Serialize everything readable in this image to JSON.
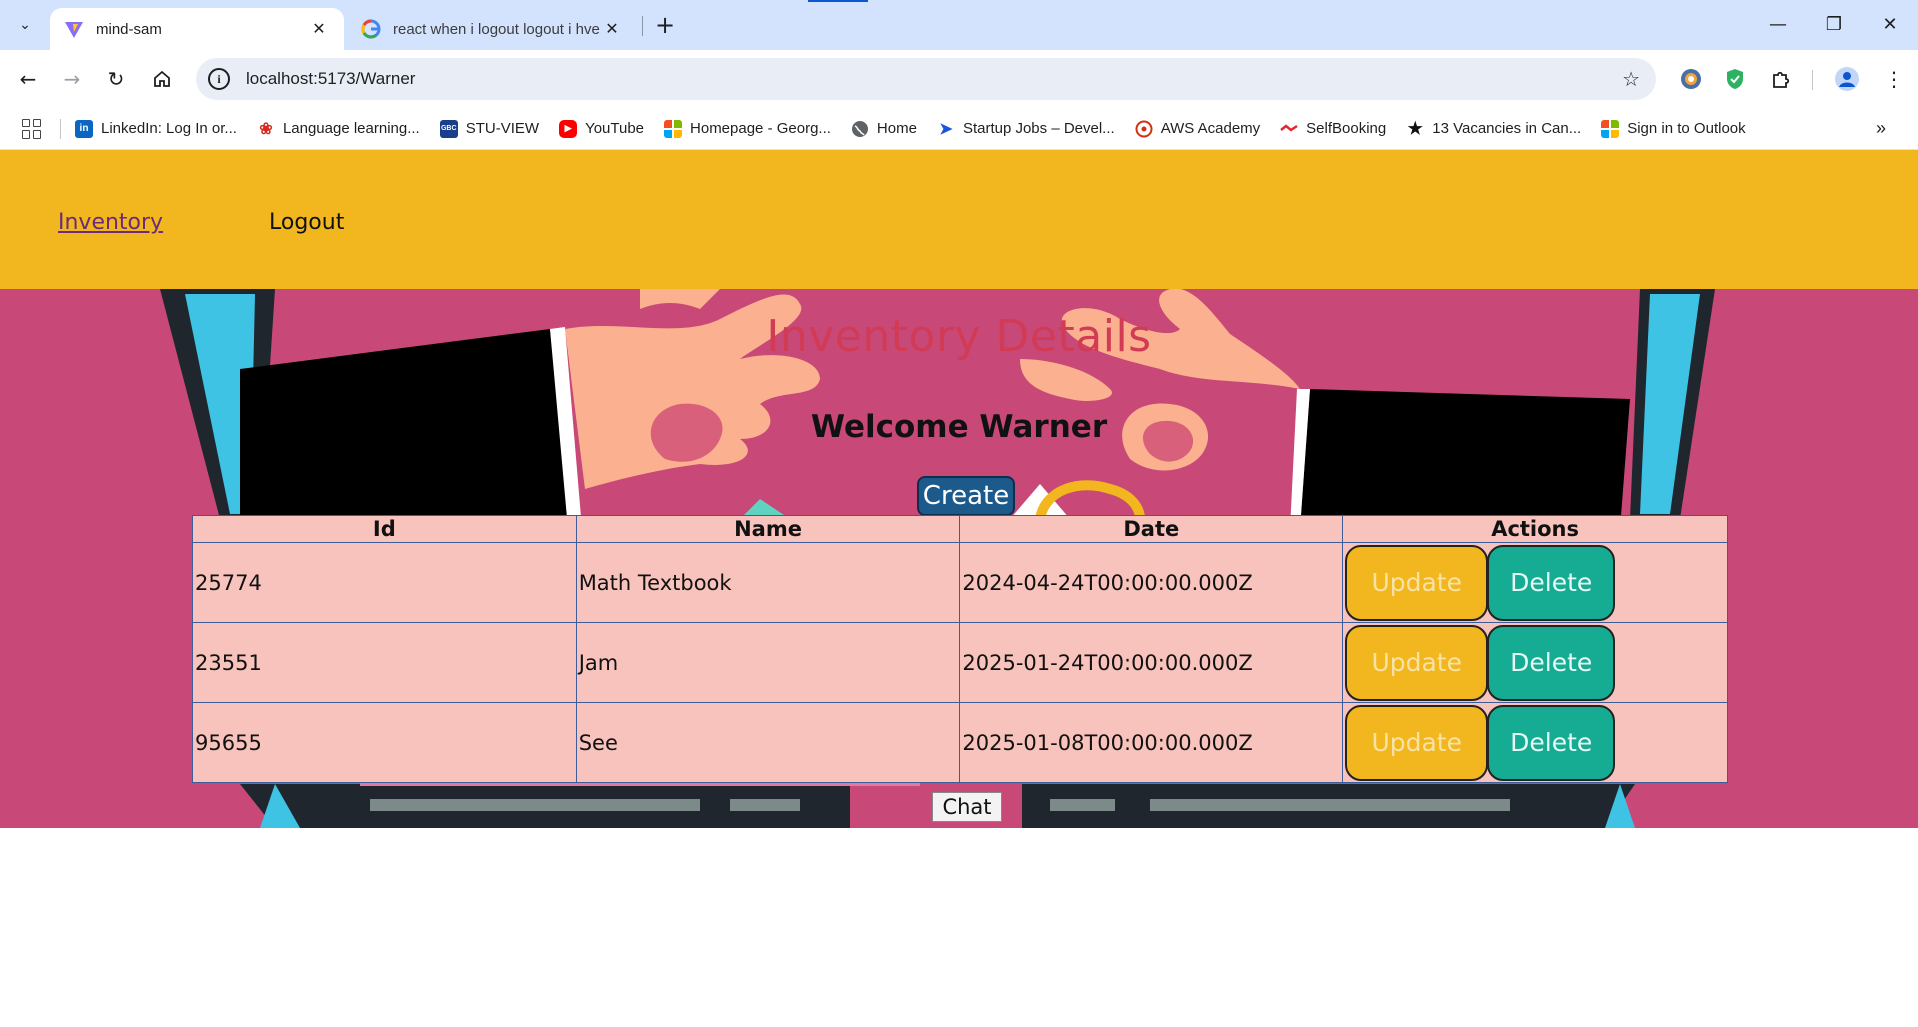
{
  "browser": {
    "tabs": [
      {
        "title": "mind-sam",
        "favicon": "vite-icon",
        "active": true
      },
      {
        "title": "react when i logout logout i hve",
        "favicon": "google-icon",
        "active": false
      }
    ],
    "url": "localhost:5173/Warner",
    "bookmarks": [
      {
        "label": "LinkedIn: Log In or...",
        "icon": "linkedin-icon",
        "color": "#0a66c2"
      },
      {
        "label": "Language learning...",
        "icon": "maple-leaf-icon",
        "color": "#d52b1e"
      },
      {
        "label": "STU-VIEW",
        "icon": "stu-view-icon",
        "color": "#1a3e8c"
      },
      {
        "label": "YouTube",
        "icon": "youtube-icon",
        "color": "#ff0000"
      },
      {
        "label": "Homepage - Georg...",
        "icon": "microsoft-icon",
        "color": "#f25022"
      },
      {
        "label": "Home",
        "icon": "globe-icon",
        "color": "#5f6368"
      },
      {
        "label": "Startup Jobs – Devel...",
        "icon": "startup-jobs-icon",
        "color": "#1a56db"
      },
      {
        "label": "AWS Academy",
        "icon": "aws-academy-icon",
        "color": "#d13212"
      },
      {
        "label": "SelfBooking",
        "icon": "selfbooking-icon",
        "color": "#e3262f"
      },
      {
        "label": "13 Vacancies in Can...",
        "icon": "star-icon",
        "color": "#111111"
      },
      {
        "label": "Sign in to Outlook",
        "icon": "microsoft-icon",
        "color": "#f25022"
      }
    ]
  },
  "nav": {
    "inventory_label": "Inventory",
    "logout_label": "Logout"
  },
  "page": {
    "title": "Inventory Details",
    "welcome": "Welcome Warner",
    "create_label": "Create",
    "chat_label": "Chat"
  },
  "table": {
    "headers": [
      "Id",
      "Name",
      "Date",
      "Actions"
    ],
    "rows": [
      {
        "id": "25774",
        "name": "Math Textbook",
        "date": "2024-04-24T00:00:00.000Z"
      },
      {
        "id": "23551",
        "name": "Jam",
        "date": "2025-01-24T00:00:00.000Z"
      },
      {
        "id": "95655",
        "name": "See",
        "date": "2025-01-08T00:00:00.000Z"
      }
    ],
    "update_label": "Update",
    "delete_label": "Delete"
  },
  "colors": {
    "header_bg": "#f2b71f",
    "hero_bg": "#c84878",
    "title_color": "#d23b55",
    "table_bg": "#f8c3bc",
    "update_bg": "#f2b71f",
    "delete_bg": "#16ab93",
    "create_bg": "#1d5a8c"
  }
}
